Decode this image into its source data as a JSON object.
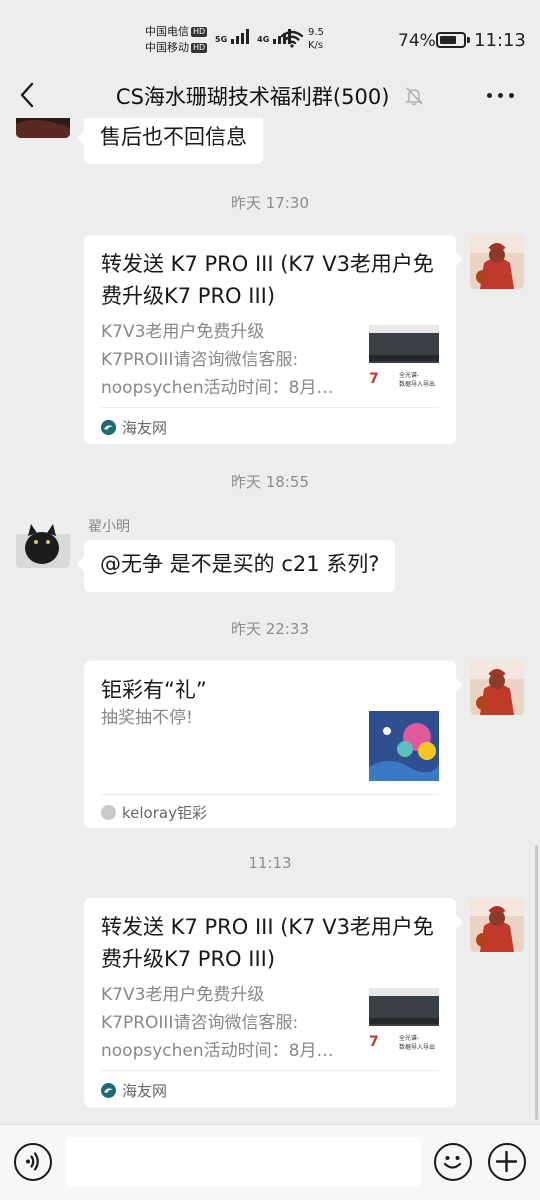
{
  "status_bar": {
    "carrier_1": "中国电信",
    "carrier_2": "中国移动",
    "hd": "HD",
    "net_1": "5G",
    "net_2": "4G",
    "speed_value": "9.5",
    "speed_unit": "K/s",
    "battery": "74%",
    "battery_level": 0.74,
    "time": "11:13"
  },
  "header": {
    "title": "CS海水珊瑚技术福利群(500)",
    "back_icon": "chevron-left-icon",
    "mute_icon": "bell-off-icon",
    "more_icon": "more-dots-icon"
  },
  "messages": {
    "m0": {
      "text": "售后也不回信息"
    },
    "t1": "昨天 17:30",
    "card1": {
      "title": "转发送 K7 PRO III (K7 V3老用户免费升级K7 PRO III)",
      "desc": "K7V3老用户免费升级\nK7PROIII请咨询微信客服:\nnoopsychen活动时间：8月…",
      "source": "海友网",
      "thumb_caption_1": "全光谱-",
      "thumb_caption_2": "数据导入导出",
      "thumb_mark": "7"
    },
    "t2": "昨天 18:55",
    "m2": {
      "sender": "翟小明",
      "text": "@无争  是不是买的 c21 系列?"
    },
    "t3": "昨天 22:33",
    "card2": {
      "title": "钜彩有“礼”",
      "desc": "抽奖抽不停!",
      "source": "keloray钜彩"
    },
    "t4": "11:13",
    "card3": {
      "title": "转发送 K7 PRO III (K7 V3老用户免费升级K7 PRO III)",
      "desc": "K7V3老用户免费升级\nK7PROIII请咨询微信客服:\nnoopsychen活动时间：8月…",
      "source": "海友网",
      "thumb_caption_1": "全光谱-",
      "thumb_caption_2": "数据导入导出",
      "thumb_mark": "7"
    }
  },
  "input_bar": {
    "voice_icon": "voice-icon",
    "emoji_icon": "emoji-icon",
    "add_icon": "plus-circle-icon",
    "input_value": ""
  }
}
